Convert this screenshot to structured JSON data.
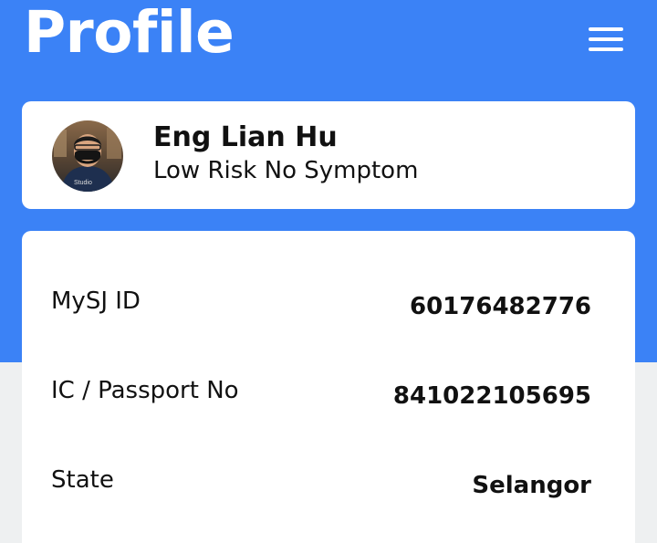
{
  "header": {
    "title": "Profile",
    "menu_icon": "hamburger-menu-icon",
    "background_color": "#3b82f6"
  },
  "profile": {
    "name": "Eng Lian Hu",
    "status": "Low Risk No Symptom",
    "avatar_watermark": "Studio"
  },
  "details": [
    {
      "label": "MySJ ID",
      "value": "60176482776"
    },
    {
      "label": "IC / Passport No",
      "value": "841022105695"
    },
    {
      "label": "State",
      "value": "Selangor"
    }
  ]
}
